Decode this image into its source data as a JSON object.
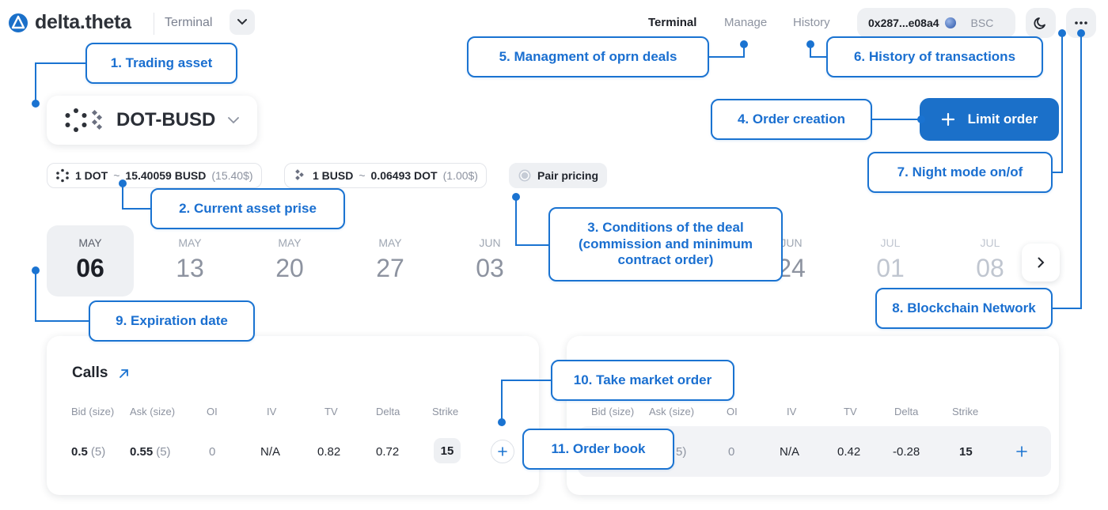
{
  "header": {
    "logo_text": "delta.theta",
    "app_switch": "Terminal",
    "nav": [
      "Terminal",
      "Manage",
      "History"
    ],
    "wallet_address": "0x287...e08a4",
    "wallet_network": "BSC",
    "icons": [
      "moon-icon",
      "more-icon"
    ]
  },
  "asset": {
    "pair": "DOT-BUSD"
  },
  "prices": {
    "dot": {
      "lhs": "1 DOT",
      "tilde": "~",
      "rhs": "15.40059 BUSD",
      "fiat": "(15.40$)"
    },
    "busd": {
      "lhs": "1 BUSD",
      "tilde": "~",
      "rhs": "0.06493 DOT",
      "fiat": "(1.00$)"
    },
    "pair_pricing": "Pair pricing"
  },
  "dates": [
    {
      "month": "MAY",
      "day": "06"
    },
    {
      "month": "MAY",
      "day": "13"
    },
    {
      "month": "MAY",
      "day": "20"
    },
    {
      "month": "MAY",
      "day": "27"
    },
    {
      "month": "JUN",
      "day": "03"
    },
    {
      "month": "JUN",
      "day": "24"
    },
    {
      "month": "JUL",
      "day": "01"
    },
    {
      "month": "JUL",
      "day": "08"
    }
  ],
  "calls": {
    "title": "Calls",
    "headers": [
      "Bid (size)",
      "Ask (size)",
      "OI",
      "IV",
      "TV",
      "Delta",
      "Strike"
    ],
    "row": {
      "bid": "0.5",
      "bid_size": "(5)",
      "ask": "0.55",
      "ask_size": "(5)",
      "oi": "0",
      "iv": "N/A",
      "tv": "0.82",
      "delta": "0.72",
      "strike": "15"
    }
  },
  "puts": {
    "headers": [
      "Bid (size)",
      "Ask (size)",
      "OI",
      "IV",
      "TV",
      "Delta",
      "Strike"
    ],
    "row": {
      "ask_size_partial": "5)",
      "oi": "0",
      "iv": "N/A",
      "tv": "0.42",
      "delta": "-0.28",
      "strike": "15"
    }
  },
  "limit_order": {
    "label": "Limit order"
  },
  "annotations": {
    "a1": "1. Trading asset",
    "a2": "2. Current asset prise",
    "a3": "3. Conditions of the deal (commission and minimum contract order)",
    "a4": "4. Order creation",
    "a5": "5. Managment of oprn deals",
    "a6": "6. History of transactions",
    "a7": "7. Night mode on/of",
    "a8": "8. Blockchain Network",
    "a9": "9. Expiration date",
    "a10": "10. Take market order",
    "a11": "11. Order book"
  },
  "colors": {
    "accent": "#1a73d1",
    "button": "#1b70c9",
    "chip": "#eef0f3"
  }
}
